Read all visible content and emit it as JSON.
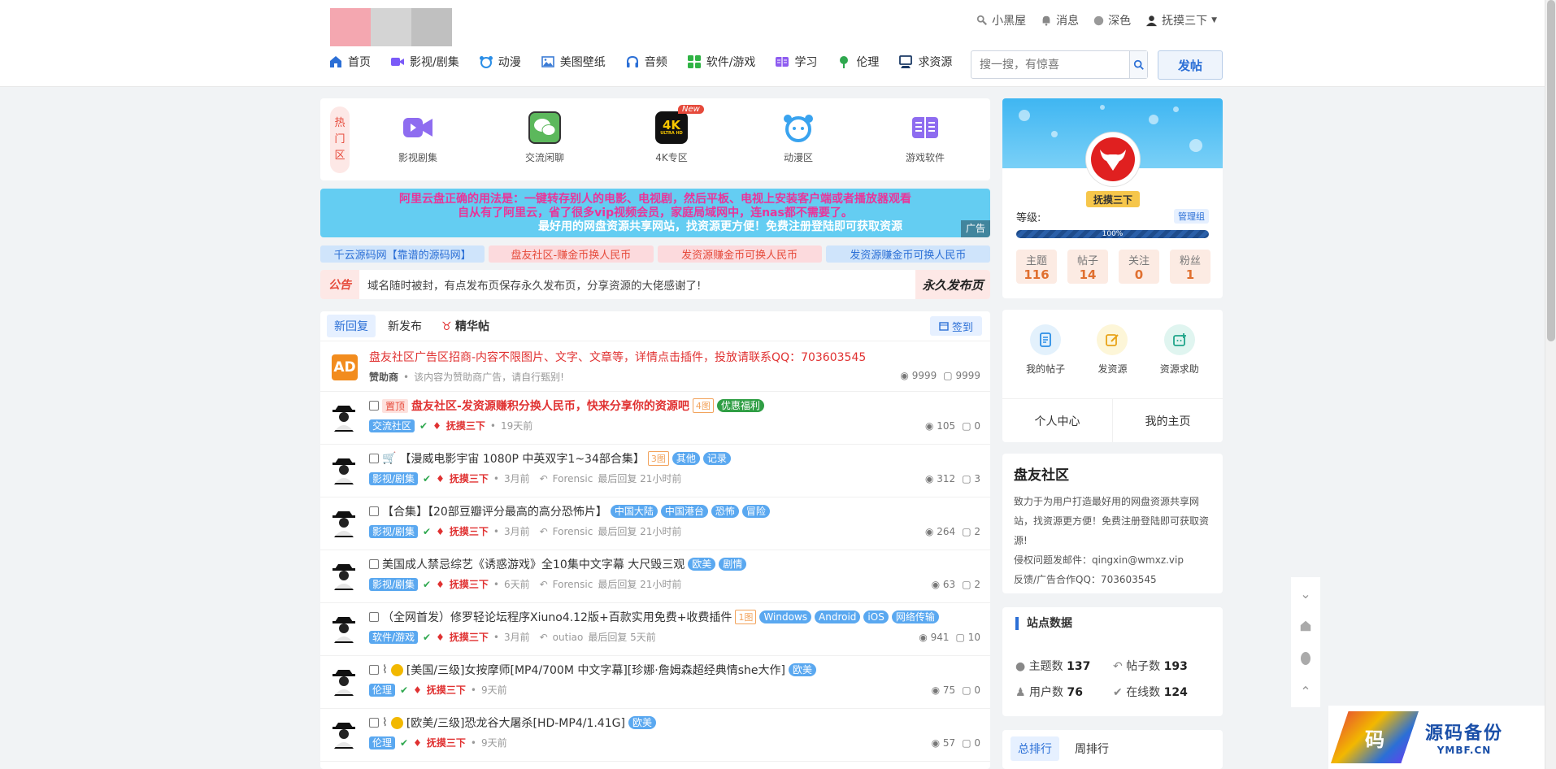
{
  "header": {
    "logo_colors": [
      "#f4a7b0",
      "#d4d4d4",
      "#c0c0c0"
    ],
    "top_links": [
      {
        "label": "小黑屋",
        "icon": "wrench-icon"
      },
      {
        "label": "消息",
        "icon": "bell-icon"
      },
      {
        "label": "深色",
        "icon": "moon-icon"
      },
      {
        "label": "抚摸三下",
        "icon": "user-icon"
      }
    ],
    "nav": [
      {
        "label": "首页",
        "icon": "home-icon",
        "color": "#2b6fd6"
      },
      {
        "label": "影视/剧集",
        "icon": "video-icon",
        "color": "#7a5af8"
      },
      {
        "label": "动漫",
        "icon": "bear-icon",
        "color": "#2b8ee6"
      },
      {
        "label": "美图壁纸",
        "icon": "image-icon",
        "color": "#3a7bd5"
      },
      {
        "label": "音频",
        "icon": "headphones-icon",
        "color": "#2b6fd6"
      },
      {
        "label": "软件/游戏",
        "icon": "apps-icon",
        "color": "#2fb344"
      },
      {
        "label": "学习",
        "icon": "book-icon",
        "color": "#8e5cf0"
      },
      {
        "label": "伦理",
        "icon": "plant-icon",
        "color": "#2fa84f"
      },
      {
        "label": "求资源",
        "icon": "request-icon",
        "color": "#1c3a66"
      }
    ],
    "search_placeholder": "搜一搜，有惊喜",
    "post_label": "发帖"
  },
  "hot": {
    "label_chars": [
      "热",
      "门",
      "区"
    ],
    "items": [
      {
        "label": "影视剧集",
        "icon": "video-icon",
        "color": "#8e6cf0"
      },
      {
        "label": "交流闲聊",
        "icon": "wechat-icon",
        "color": "#5cb85c"
      },
      {
        "label": "4K专区",
        "icon": "4k-icon",
        "color": "#111111",
        "badge": "New"
      },
      {
        "label": "动漫区",
        "icon": "bear-icon",
        "color": "#39a3ef"
      },
      {
        "label": "游戏软件",
        "icon": "book-icon",
        "color": "#8e6cf0"
      }
    ]
  },
  "ad_banner": {
    "line1": "阿里云盘正确的用法是：一键转存别人的电影、电视剧，然后平板、电视上安装客户端或者播放器观看",
    "line2": "自从有了阿里云，省了很多vip视频会员，家庭局域网中，连nas都不需要了。",
    "line3": "最好用的网盘资源共享网站，找资源更方便！免费注册登陆即可获取资源",
    "tag": "广告"
  },
  "links": [
    {
      "label": "千云源码网【靠谱的源码网】",
      "bg": "#cfe4fb",
      "color": "#2b6fd6"
    },
    {
      "label": "盘友社区-赚金币换人民币",
      "bg": "#fcdadd",
      "color": "#e64a3b"
    },
    {
      "label": "发资源赚金币可换人民币",
      "bg": "#fcdadd",
      "color": "#e64a3b"
    },
    {
      "label": "发资源赚金币可换人民币",
      "bg": "#cfe4fb",
      "color": "#2b6fd6"
    }
  ],
  "notice": {
    "label": "公告",
    "text": "域名随时被封，有点发布页保存永久发布页，分享资源的大佬感谢了!",
    "right": "永久发布页"
  },
  "threads": {
    "tabs": [
      "新回复",
      "新发布",
      "精华帖"
    ],
    "sign_label": "签到",
    "ad": {
      "avatar_text": "AD",
      "title": "盘友社区广告区招商-内容不限图片、文字、文章等，详情点击插件，投放请联系QQ：703603545",
      "sponsor": "赞助商",
      "note": "该内容为赞助商广告，请自行甄别!",
      "views": "9999",
      "replies": "9999"
    },
    "rows": [
      {
        "prefix": "置顶",
        "title": "盘友社区-发资源赚积分换人民币，快来分享你的资源吧",
        "img": "4图",
        "tags": [
          {
            "t": "优惠福利",
            "c": "#2f9e44"
          }
        ],
        "cat": "交流社区",
        "user": "抚摸三下",
        "time": "19天前",
        "reply_user": "",
        "reply_time": "",
        "views": "105",
        "replies": "0",
        "title_color": "#e03131",
        "bold": true
      },
      {
        "prefix": "",
        "title": "【漫威电影宇宙 1080P 中英双字1~34部合集】",
        "img": "3图",
        "tags": [
          {
            "t": "其他",
            "c": "#5aa8f0"
          },
          {
            "t": "记录",
            "c": "#5aa8f0"
          }
        ],
        "cat": "影视/剧集",
        "user": "抚摸三下",
        "time": "3月前",
        "reply_user": "Forensic",
        "reply_time": "最后回复 21小时前",
        "views": "312",
        "replies": "3",
        "title_color": "#333",
        "cart": true
      },
      {
        "prefix": "",
        "title": "【合集】【20部豆瓣评分最高的高分恐怖片】",
        "img": "",
        "tags": [
          {
            "t": "中国大陆",
            "c": "#5aa8f0"
          },
          {
            "t": "中国港台",
            "c": "#5aa8f0"
          },
          {
            "t": "恐怖",
            "c": "#5aa8f0"
          },
          {
            "t": "冒险",
            "c": "#5aa8f0"
          }
        ],
        "cat": "影视/剧集",
        "user": "抚摸三下",
        "time": "3月前",
        "reply_user": "Forensic",
        "reply_time": "最后回复 21小时前",
        "views": "264",
        "replies": "2",
        "title_color": "#333"
      },
      {
        "prefix": "",
        "title": "美国成人禁忌综艺《诱惑游戏》全10集中文字幕 大尺毁三观",
        "img": "",
        "tags": [
          {
            "t": "欧美",
            "c": "#5aa8f0"
          },
          {
            "t": "剧情",
            "c": "#5aa8f0"
          }
        ],
        "cat": "影视/剧集",
        "user": "抚摸三下",
        "time": "6天前",
        "reply_user": "Forensic",
        "reply_time": "最后回复 21小时前",
        "views": "63",
        "replies": "2",
        "title_color": "#333"
      },
      {
        "prefix": "",
        "title": "（全网首发）修罗轻论坛程序Xiuno4.12版+百款实用免费+收费插件",
        "img": "1图",
        "tags": [
          {
            "t": "Windows",
            "c": "#5aa8f0"
          },
          {
            "t": "Android",
            "c": "#5aa8f0"
          },
          {
            "t": "iOS",
            "c": "#5aa8f0"
          },
          {
            "t": "网络传输",
            "c": "#5aa8f0"
          }
        ],
        "cat": "软件/游戏",
        "user": "抚摸三下",
        "time": "3月前",
        "reply_user": "outiao",
        "reply_time": "最后回复 5天前",
        "views": "941",
        "replies": "10",
        "title_color": "#333"
      },
      {
        "prefix": "",
        "title": "[美国/三级]女按摩师[MP4/700M 中文字幕][珍娜·詹姆森超经典情she大作]",
        "img": "",
        "tags": [
          {
            "t": "欧美",
            "c": "#5aa8f0"
          }
        ],
        "cat": "伦理",
        "user": "抚摸三下",
        "time": "9天前",
        "reply_user": "",
        "reply_time": "",
        "views": "75",
        "replies": "0",
        "title_color": "#333",
        "clip": true,
        "medal": true
      },
      {
        "prefix": "",
        "title": "[欧美/三级]恐龙谷大屠杀[HD-MP4/1.41G]",
        "img": "",
        "tags": [
          {
            "t": "欧美",
            "c": "#5aa8f0"
          }
        ],
        "cat": "伦理",
        "user": "抚摸三下",
        "time": "9天前",
        "reply_user": "",
        "reply_time": "",
        "views": "57",
        "replies": "0",
        "title_color": "#333",
        "clip": true,
        "medal": true
      }
    ]
  },
  "profile": {
    "name": "抚摸三下",
    "level_label": "等级:",
    "group": "管理组",
    "progress": "100%",
    "stats": [
      {
        "label": "主题",
        "value": "116"
      },
      {
        "label": "帖子",
        "value": "14"
      },
      {
        "label": "关注",
        "value": "0"
      },
      {
        "label": "粉丝",
        "value": "1"
      }
    ]
  },
  "actions": {
    "items": [
      {
        "label": "我的帖子",
        "icon": "document-icon",
        "bg": "#e3f1fc",
        "color": "#2b8ee6"
      },
      {
        "label": "发资源",
        "icon": "edit-icon",
        "bg": "#fdf6d8",
        "color": "#e8a317"
      },
      {
        "label": "资源求助",
        "icon": "help-icon",
        "bg": "#e0f5f0",
        "color": "#20a58a"
      }
    ],
    "footer": [
      "个人中心",
      "我的主页"
    ]
  },
  "about": {
    "title": "盘友社区",
    "desc": "致力于为用户打造最好用的网盘资源共享网站，找资源更方便！免费注册登陆即可获取资源!",
    "email": "侵权问题发邮件：qingxin@wmxz.vip",
    "qq": "反馈/广告合作QQ：703603545"
  },
  "site_stats": {
    "title": "站点数据",
    "items": [
      {
        "label": "主题数",
        "value": "137",
        "icon": "chat-icon"
      },
      {
        "label": "帖子数",
        "value": "193",
        "icon": "reply-icon"
      },
      {
        "label": "用户数",
        "value": "76",
        "icon": "user-icon"
      },
      {
        "label": "在线数",
        "value": "124",
        "icon": "check-icon"
      }
    ]
  },
  "rank": {
    "tabs": [
      "总排行",
      "周排行"
    ]
  },
  "watermark": {
    "glyph": "码",
    "text": "源码备份",
    "sub": "YMBF.CN"
  }
}
